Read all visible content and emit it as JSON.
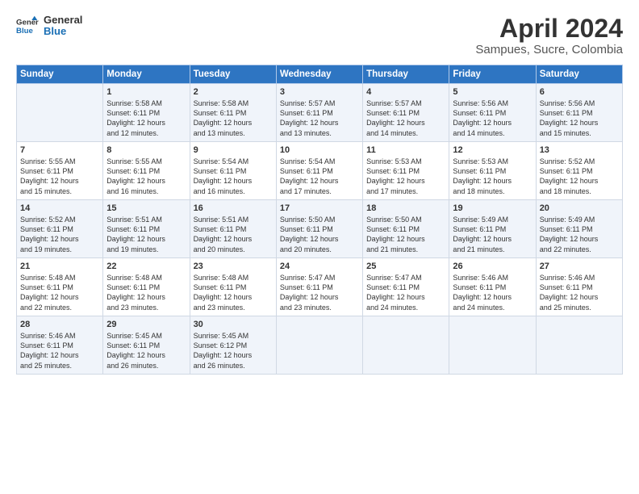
{
  "logo": {
    "line1": "General",
    "line2": "Blue"
  },
  "title": "April 2024",
  "location": "Sampues, Sucre, Colombia",
  "header_days": [
    "Sunday",
    "Monday",
    "Tuesday",
    "Wednesday",
    "Thursday",
    "Friday",
    "Saturday"
  ],
  "weeks": [
    [
      {
        "day": "",
        "lines": []
      },
      {
        "day": "1",
        "lines": [
          "Sunrise: 5:58 AM",
          "Sunset: 6:11 PM",
          "Daylight: 12 hours",
          "and 12 minutes."
        ]
      },
      {
        "day": "2",
        "lines": [
          "Sunrise: 5:58 AM",
          "Sunset: 6:11 PM",
          "Daylight: 12 hours",
          "and 13 minutes."
        ]
      },
      {
        "day": "3",
        "lines": [
          "Sunrise: 5:57 AM",
          "Sunset: 6:11 PM",
          "Daylight: 12 hours",
          "and 13 minutes."
        ]
      },
      {
        "day": "4",
        "lines": [
          "Sunrise: 5:57 AM",
          "Sunset: 6:11 PM",
          "Daylight: 12 hours",
          "and 14 minutes."
        ]
      },
      {
        "day": "5",
        "lines": [
          "Sunrise: 5:56 AM",
          "Sunset: 6:11 PM",
          "Daylight: 12 hours",
          "and 14 minutes."
        ]
      },
      {
        "day": "6",
        "lines": [
          "Sunrise: 5:56 AM",
          "Sunset: 6:11 PM",
          "Daylight: 12 hours",
          "and 15 minutes."
        ]
      }
    ],
    [
      {
        "day": "7",
        "lines": [
          "Sunrise: 5:55 AM",
          "Sunset: 6:11 PM",
          "Daylight: 12 hours",
          "and 15 minutes."
        ]
      },
      {
        "day": "8",
        "lines": [
          "Sunrise: 5:55 AM",
          "Sunset: 6:11 PM",
          "Daylight: 12 hours",
          "and 16 minutes."
        ]
      },
      {
        "day": "9",
        "lines": [
          "Sunrise: 5:54 AM",
          "Sunset: 6:11 PM",
          "Daylight: 12 hours",
          "and 16 minutes."
        ]
      },
      {
        "day": "10",
        "lines": [
          "Sunrise: 5:54 AM",
          "Sunset: 6:11 PM",
          "Daylight: 12 hours",
          "and 17 minutes."
        ]
      },
      {
        "day": "11",
        "lines": [
          "Sunrise: 5:53 AM",
          "Sunset: 6:11 PM",
          "Daylight: 12 hours",
          "and 17 minutes."
        ]
      },
      {
        "day": "12",
        "lines": [
          "Sunrise: 5:53 AM",
          "Sunset: 6:11 PM",
          "Daylight: 12 hours",
          "and 18 minutes."
        ]
      },
      {
        "day": "13",
        "lines": [
          "Sunrise: 5:52 AM",
          "Sunset: 6:11 PM",
          "Daylight: 12 hours",
          "and 18 minutes."
        ]
      }
    ],
    [
      {
        "day": "14",
        "lines": [
          "Sunrise: 5:52 AM",
          "Sunset: 6:11 PM",
          "Daylight: 12 hours",
          "and 19 minutes."
        ]
      },
      {
        "day": "15",
        "lines": [
          "Sunrise: 5:51 AM",
          "Sunset: 6:11 PM",
          "Daylight: 12 hours",
          "and 19 minutes."
        ]
      },
      {
        "day": "16",
        "lines": [
          "Sunrise: 5:51 AM",
          "Sunset: 6:11 PM",
          "Daylight: 12 hours",
          "and 20 minutes."
        ]
      },
      {
        "day": "17",
        "lines": [
          "Sunrise: 5:50 AM",
          "Sunset: 6:11 PM",
          "Daylight: 12 hours",
          "and 20 minutes."
        ]
      },
      {
        "day": "18",
        "lines": [
          "Sunrise: 5:50 AM",
          "Sunset: 6:11 PM",
          "Daylight: 12 hours",
          "and 21 minutes."
        ]
      },
      {
        "day": "19",
        "lines": [
          "Sunrise: 5:49 AM",
          "Sunset: 6:11 PM",
          "Daylight: 12 hours",
          "and 21 minutes."
        ]
      },
      {
        "day": "20",
        "lines": [
          "Sunrise: 5:49 AM",
          "Sunset: 6:11 PM",
          "Daylight: 12 hours",
          "and 22 minutes."
        ]
      }
    ],
    [
      {
        "day": "21",
        "lines": [
          "Sunrise: 5:48 AM",
          "Sunset: 6:11 PM",
          "Daylight: 12 hours",
          "and 22 minutes."
        ]
      },
      {
        "day": "22",
        "lines": [
          "Sunrise: 5:48 AM",
          "Sunset: 6:11 PM",
          "Daylight: 12 hours",
          "and 23 minutes."
        ]
      },
      {
        "day": "23",
        "lines": [
          "Sunrise: 5:48 AM",
          "Sunset: 6:11 PM",
          "Daylight: 12 hours",
          "and 23 minutes."
        ]
      },
      {
        "day": "24",
        "lines": [
          "Sunrise: 5:47 AM",
          "Sunset: 6:11 PM",
          "Daylight: 12 hours",
          "and 23 minutes."
        ]
      },
      {
        "day": "25",
        "lines": [
          "Sunrise: 5:47 AM",
          "Sunset: 6:11 PM",
          "Daylight: 12 hours",
          "and 24 minutes."
        ]
      },
      {
        "day": "26",
        "lines": [
          "Sunrise: 5:46 AM",
          "Sunset: 6:11 PM",
          "Daylight: 12 hours",
          "and 24 minutes."
        ]
      },
      {
        "day": "27",
        "lines": [
          "Sunrise: 5:46 AM",
          "Sunset: 6:11 PM",
          "Daylight: 12 hours",
          "and 25 minutes."
        ]
      }
    ],
    [
      {
        "day": "28",
        "lines": [
          "Sunrise: 5:46 AM",
          "Sunset: 6:11 PM",
          "Daylight: 12 hours",
          "and 25 minutes."
        ]
      },
      {
        "day": "29",
        "lines": [
          "Sunrise: 5:45 AM",
          "Sunset: 6:11 PM",
          "Daylight: 12 hours",
          "and 26 minutes."
        ]
      },
      {
        "day": "30",
        "lines": [
          "Sunrise: 5:45 AM",
          "Sunset: 6:12 PM",
          "Daylight: 12 hours",
          "and 26 minutes."
        ]
      },
      {
        "day": "",
        "lines": []
      },
      {
        "day": "",
        "lines": []
      },
      {
        "day": "",
        "lines": []
      },
      {
        "day": "",
        "lines": []
      }
    ]
  ]
}
